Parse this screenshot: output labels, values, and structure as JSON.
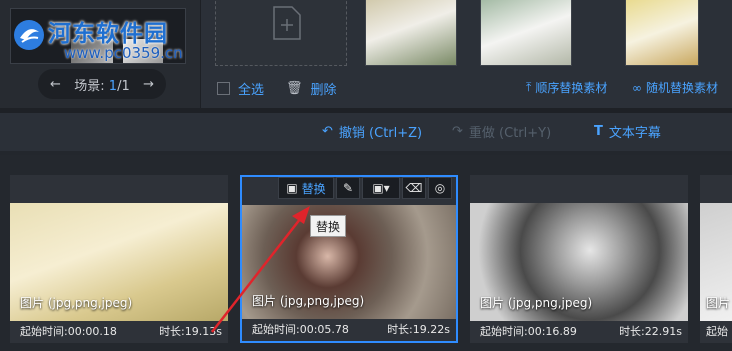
{
  "watermark": {
    "title": "河东软件园",
    "url": "www.pc0359.cn"
  },
  "scene": {
    "label": "场景:",
    "current": "1",
    "total": "/1"
  },
  "materials_toolbar": {
    "select_all": "全选",
    "delete": "删除",
    "seq_replace": "顺序替换素材",
    "random_replace": "随机替换素材"
  },
  "edit_bar": {
    "undo": "撤销 (Ctrl+Z)",
    "redo": "重做 (Ctrl+Y)",
    "subtitle": "文本字幕"
  },
  "card_tools": {
    "replace": "替换",
    "tooltip": "替换"
  },
  "cards": [
    {
      "type": "图片 (jpg,png,jpeg)",
      "start": "起始时间:00:00.18",
      "duration": "时长:19.13s"
    },
    {
      "type": "图片 (jpg,png,jpeg)",
      "start": "起始时间:00:05.78",
      "duration": "时长:19.22s"
    },
    {
      "type": "图片 (jpg,png,jpeg)",
      "start": "起始时间:00:16.89",
      "duration": "时长:22.91s"
    },
    {
      "type": "图片",
      "start": "起始",
      "duration": ""
    }
  ],
  "colors": {
    "accent": "#2f8cff",
    "link": "#4aa3ff",
    "background": "#23272d",
    "arrow": "#e0242b"
  }
}
